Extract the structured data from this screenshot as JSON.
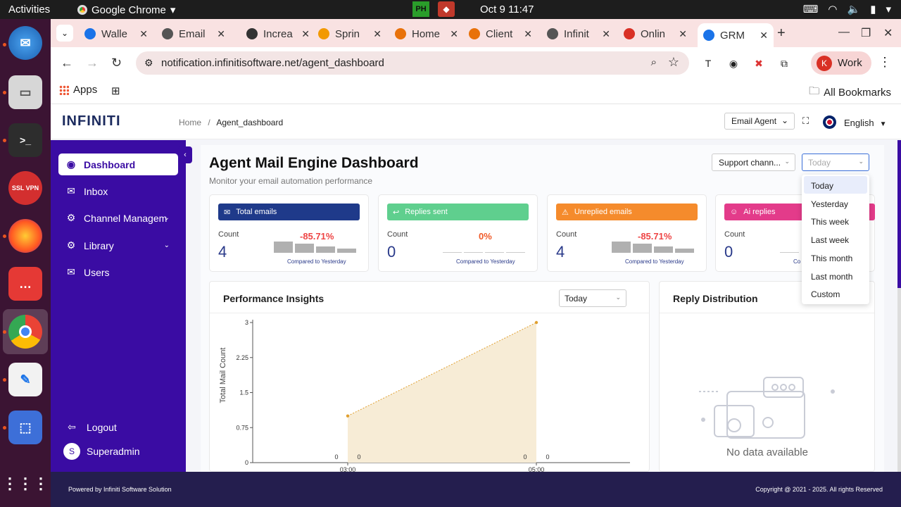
{
  "os": {
    "activities": "Activities",
    "app_name": "Google Chrome",
    "clock": "Oct 9  11:47"
  },
  "browser": {
    "tabs": [
      {
        "label": "Walle",
        "color": "#1a73e8"
      },
      {
        "label": "Email",
        "color": "#555555"
      },
      {
        "label": "Increa",
        "color": "#333333"
      },
      {
        "label": "Sprin",
        "color": "#f29900"
      },
      {
        "label": "Home",
        "color": "#e8710a"
      },
      {
        "label": "Client",
        "color": "#e8710a"
      },
      {
        "label": "Infinit",
        "color": "#555555"
      },
      {
        "label": "Onlin",
        "color": "#d93025"
      },
      {
        "label": "GRM",
        "color": "#1a73e8"
      }
    ],
    "url": "notification.infinitisoftware.net/agent_dashboard",
    "profile_initial": "K",
    "profile_label": "Work",
    "bookmarks": {
      "apps": "Apps",
      "all": "All Bookmarks"
    }
  },
  "header": {
    "logo": "INFINITI",
    "breadcrumb": {
      "home": "Home",
      "sep": "/",
      "current": "Agent_dashboard"
    },
    "agent_select": "Email Agent",
    "language": "English"
  },
  "sidebar": {
    "items": [
      {
        "label": "Dashboard",
        "icon": "dashboard-icon"
      },
      {
        "label": "Inbox",
        "icon": "mail-icon"
      },
      {
        "label": "Channel Managem",
        "icon": "gear-icon"
      },
      {
        "label": "Library",
        "icon": "gear-icon"
      },
      {
        "label": "Users",
        "icon": "mail-icon"
      }
    ],
    "logout": "Logout",
    "user_initial": "S",
    "user": "Superadmin"
  },
  "main": {
    "title": "Agent Mail Engine Dashboard",
    "subtitle": "Monitor your email automation performance",
    "channel_select": "Support chann...",
    "date_select_placeholder": "Today",
    "cards": [
      {
        "title": "Total emails",
        "count_label": "Count",
        "count": "4",
        "pct": "-85.71%",
        "compare": "Compared to Yesterday",
        "color": "#1f3a8a",
        "bars": [
          1,
          0.8,
          0.55,
          0.35
        ]
      },
      {
        "title": "Replies sent",
        "count_label": "Count",
        "count": "0",
        "pct": "0%",
        "compare": "Compared to Yesterday",
        "color": "#5fcf8e",
        "bars": [
          0,
          0,
          0,
          0
        ]
      },
      {
        "title": "Unreplied emails",
        "count_label": "Count",
        "count": "4",
        "pct": "-85.71%",
        "compare": "Compared to Yesterday",
        "color": "#f58b2c",
        "bars": [
          1,
          0.8,
          0.55,
          0.35
        ]
      },
      {
        "title": "Ai replies",
        "count_label": "Count",
        "count": "0",
        "pct": "",
        "compare": "Co",
        "color": "#e33b8a",
        "bars": [
          0
        ]
      }
    ],
    "performance": {
      "title": "Performance Insights",
      "select": "Today"
    },
    "reply_distribution": {
      "title": "Reply Distribution",
      "empty": "No data available"
    },
    "date_dropdown": [
      "Today",
      "Yesterday",
      "This week",
      "Last week",
      "This month",
      "Last month",
      "Custom"
    ]
  },
  "chart_data": {
    "type": "area",
    "ylabel": "Total Mail Count",
    "y_ticks": [
      "0",
      "0.75",
      "1.5",
      "2.25",
      "3"
    ],
    "ylim": [
      0,
      3
    ],
    "x_ticks": [
      "03:00",
      "05:00"
    ],
    "series": [
      {
        "x": [
          "03:00",
          "05:00"
        ],
        "values": [
          1,
          3
        ]
      }
    ],
    "annotations": [
      "0",
      "0",
      "0",
      "0"
    ],
    "fill_color": "#f7ecd6",
    "line_color": "#e0a030"
  },
  "footer": {
    "left": "Powered by Infiniti Software Solution",
    "right": "Copyright @ 2021 - 2025. All rights Reserved"
  }
}
